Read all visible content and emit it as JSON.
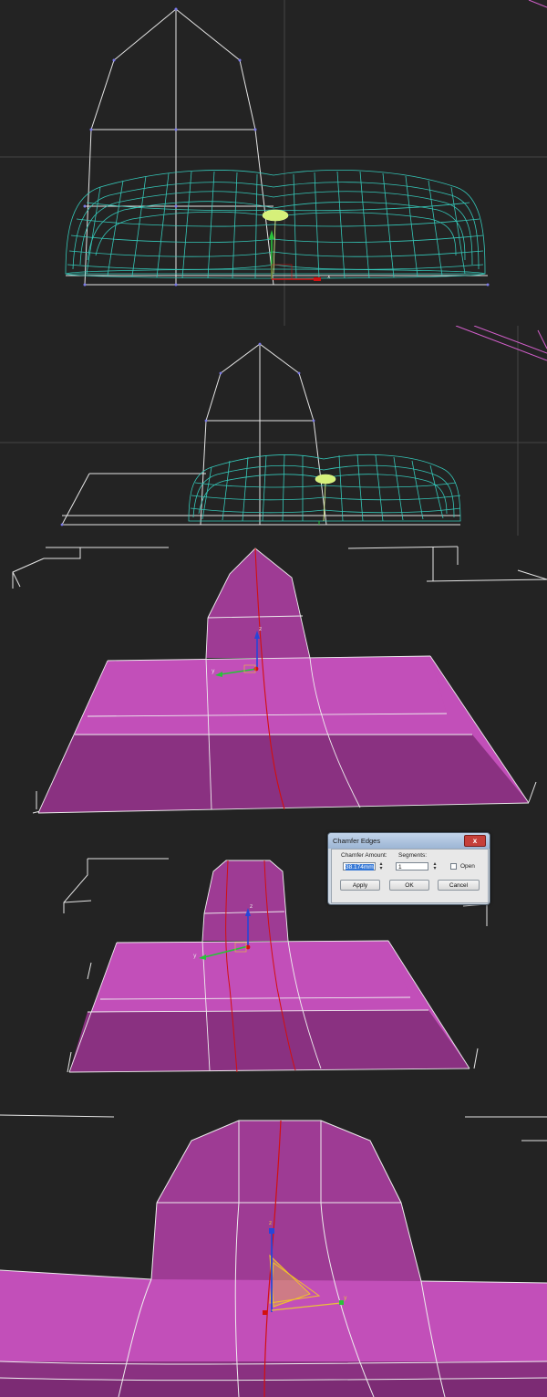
{
  "viewports": [
    {
      "name": "viewport-1-wireframe"
    },
    {
      "name": "viewport-2-wireframe"
    },
    {
      "name": "viewport-3-shaded"
    },
    {
      "name": "viewport-4-shaded"
    },
    {
      "name": "viewport-5-shaded"
    }
  ],
  "axes": {
    "x": "x",
    "y": "y",
    "z": "z"
  },
  "dialog": {
    "title": "Chamfer Edges",
    "close_glyph": "x",
    "chamfer_amount_label": "Chamfer Amount:",
    "chamfer_amount_value": "38.174mm",
    "segments_label": "Segments:",
    "segments_value": "1",
    "open_label": "Open",
    "open_checked": false,
    "apply_label": "Apply",
    "ok_label": "OK",
    "cancel_label": "Cancel"
  },
  "colors": {
    "viewport_bg": "#232323",
    "wire_cyan": "#35c7b8",
    "wire_white": "#e6e6e6",
    "mesh_magenta": "#c24fb9",
    "mesh_shadow": "#8a3181",
    "edge_selected": "#d21010"
  }
}
